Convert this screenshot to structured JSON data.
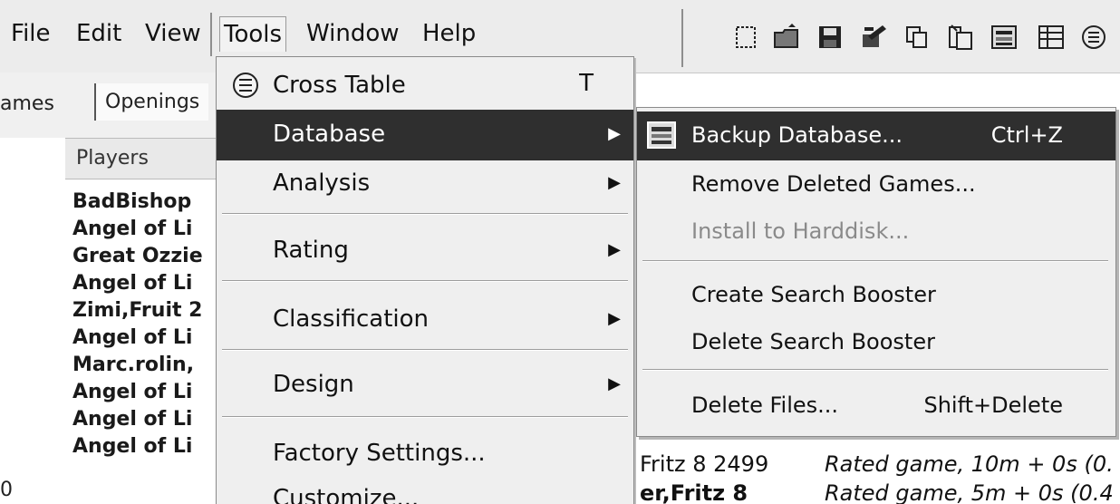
{
  "menubar": {
    "items": [
      {
        "label": "File"
      },
      {
        "label": "Edit"
      },
      {
        "label": "View"
      },
      {
        "label": "Tools"
      },
      {
        "label": "Window"
      },
      {
        "label": "Help"
      }
    ]
  },
  "toolbar": {
    "icons": [
      "new-icon",
      "open-icon",
      "save-icon",
      "edit-icon",
      "copy-icon",
      "paste-icon",
      "database-icon",
      "table-icon"
    ]
  },
  "left_panel": {
    "tabs": [
      {
        "label": "ames"
      },
      {
        "label": "Openings"
      }
    ],
    "list_header": "Players",
    "players": [
      "BadBishop",
      "Angel of Li",
      "Great Ozzie",
      "Angel of Li",
      "Zimi,Fruit 2",
      "Angel of Li",
      "Marc.rolin,",
      "Angel of Li",
      "Angel of Li",
      "Angel of Li"
    ],
    "row_prefix": "0"
  },
  "tools_menu": {
    "items": [
      {
        "label": "Cross Table",
        "shortcut": "T",
        "icon": "cross-table-icon"
      },
      {
        "label": "Database",
        "submenu": true,
        "highlighted": true
      },
      {
        "label": "Analysis",
        "submenu": true
      },
      {
        "label": "Rating",
        "submenu": true
      },
      {
        "label": "Classification",
        "submenu": true
      },
      {
        "label": "Design",
        "submenu": true
      },
      {
        "label": "Factory Settings..."
      },
      {
        "label": "Customize..."
      }
    ]
  },
  "database_submenu": {
    "items": [
      {
        "label": "Backup Database...",
        "shortcut": "Ctrl+Z",
        "highlighted": true,
        "icon": "backup-database-icon"
      },
      {
        "label": "Remove Deleted Games..."
      },
      {
        "label": "Install to Harddisk...",
        "disabled": true
      },
      {
        "label": "Create Search Booster"
      },
      {
        "label": "Delete Search Booster"
      },
      {
        "label": "Delete Files...",
        "shortcut": "Shift+Delete"
      }
    ]
  },
  "background_games": [
    {
      "player": "Fritz 8 2499",
      "info": "Rated game, 10m + 0s (0."
    },
    {
      "player": "er,Fritz 8",
      "info": "Rated game, 5m + 0s (0.4"
    }
  ],
  "colors": {
    "menu_bg": "#efefef",
    "highlight": "#2f2f2f",
    "highlight_text": "#ffffff",
    "disabled_text": "#8a8a8a"
  }
}
